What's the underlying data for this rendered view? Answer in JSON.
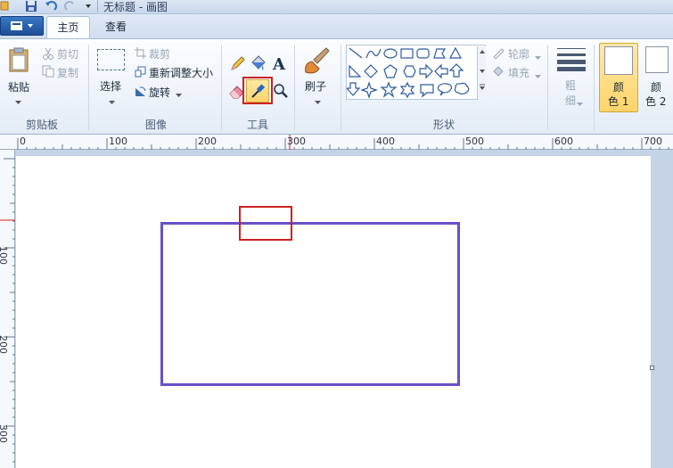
{
  "window": {
    "title": "无标题 - 画图"
  },
  "tabs": [
    {
      "label": "主页"
    },
    {
      "label": "查看"
    }
  ],
  "clipboard": {
    "paste_label": "粘贴",
    "cut_label": "剪切",
    "copy_label": "复制",
    "group_label": "剪贴板"
  },
  "image": {
    "select_label": "选择",
    "crop_label": "裁剪",
    "resize_label": "重新调整大小",
    "rotate_label": "旋转",
    "group_label": "图像"
  },
  "tools": {
    "group_label": "工具",
    "selected_tool": "color-picker"
  },
  "brushes": {
    "label": "刷子"
  },
  "shapes": {
    "group_label": "形状",
    "outline_label": "轮廓",
    "fill_label": "填充",
    "items": [
      "line",
      "curve",
      "oval",
      "rectangle",
      "rounded-rectangle",
      "polygon",
      "triangle",
      "right-triangle",
      "diamond",
      "pentagon",
      "hexagon",
      "right-arrow",
      "left-arrow",
      "up-arrow",
      "down-arrow",
      "four-point-star",
      "five-point-star",
      "six-point-star",
      "rounded-callout",
      "oval-callout",
      "cloud-callout"
    ]
  },
  "size": {
    "label_line1": "粗",
    "label_line2": "细"
  },
  "colors": {
    "color1_line1": "颜",
    "color1_line2": "色 1",
    "color2_line1": "颜",
    "color2_line2": "色 2"
  },
  "ruler": {
    "h_labels": [
      "0",
      "100",
      "200",
      "300",
      "400",
      "500",
      "600",
      "700"
    ],
    "v_labels": [
      "100",
      "200",
      "300"
    ]
  },
  "canvas_content": {
    "stroke_color": "#6a4fc7",
    "highlight_color": "#cc2222"
  }
}
